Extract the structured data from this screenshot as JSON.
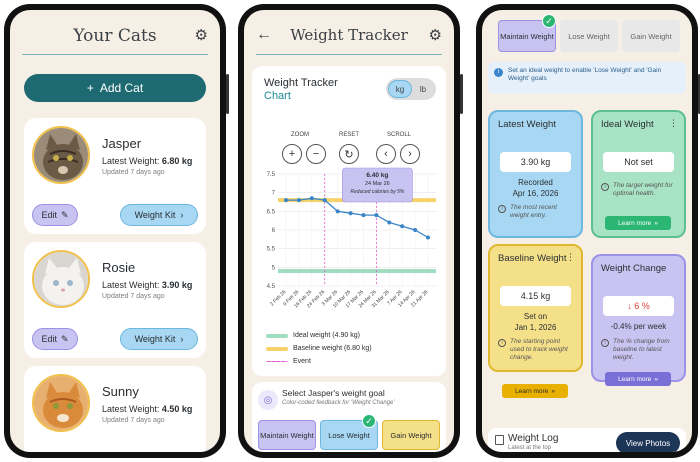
{
  "screen1": {
    "title": "Your Cats",
    "add_cat_label": "Add Cat",
    "cats": [
      {
        "name": "Jasper",
        "weight_prefix": "Latest Weight: ",
        "weight": "6.80 kg",
        "updated": "Updated 7 days ago",
        "edit_label": "Edit",
        "kit_label": "Weight Kit"
      },
      {
        "name": "Rosie",
        "weight_prefix": "Latest Weight: ",
        "weight": "3.90 kg",
        "updated": "Updated 7 days ago",
        "edit_label": "Edit",
        "kit_label": "Weight Kit"
      },
      {
        "name": "Sunny",
        "weight_prefix": "Latest Weight: ",
        "weight": "4.50 kg",
        "updated": "Updated 7 days ago"
      }
    ]
  },
  "screen2": {
    "title": "Weight Tracker",
    "card_title": "Weight Tracker",
    "card_subtitle": "Chart",
    "unit_kg": "kg",
    "unit_lb": "lb",
    "controls": {
      "zoom": "ZOOM",
      "reset": "RESET",
      "scroll": "SCROLL"
    },
    "tooltip": {
      "value": "6.40 kg",
      "date": "24 Mar 26",
      "note": "Reduced calories by 5%"
    },
    "legend": [
      {
        "label": "Ideal weight (4.90 kg)",
        "color": "#9fdcc0"
      },
      {
        "label": "Baseline weight (6.80 kg)",
        "color": "#f5d26a"
      },
      {
        "label": "Event",
        "color": "#e35bd0"
      }
    ],
    "goal_title": "Select Jasper's weight goal",
    "goal_subtitle": "Color-coded feedback for 'Weight Change'",
    "goal_options": [
      "Maintain Weight",
      "Lose Weight",
      "Gain Weight"
    ],
    "goal_selected": "Lose Weight"
  },
  "chart_data": {
    "type": "line",
    "x": [
      "2 Feb 26",
      "9 Feb 26",
      "16 Feb 26",
      "24 Feb 26",
      "3 Mar 26",
      "10 Mar 26",
      "17 Mar 26",
      "24 Mar 26",
      "31 Mar 26",
      "7 Apr 26",
      "14 Apr 26",
      "21 Apr 26"
    ],
    "series": [
      {
        "values": [
          6.8,
          6.8,
          6.85,
          6.8,
          6.5,
          6.45,
          6.4,
          6.4,
          6.2,
          6.1,
          6.0,
          5.8
        ]
      }
    ],
    "ideal_weight": 4.9,
    "baseline_weight": 6.8,
    "events": [
      "24 Feb 26",
      "24 Mar 26"
    ],
    "yticks": [
      "7.5",
      "7",
      "6.5",
      "6",
      "5.5",
      "5",
      "4.5"
    ],
    "ylim": [
      4.5,
      7.5
    ],
    "grid": true
  },
  "screen3": {
    "goal_tabs": [
      "Maintain Weight",
      "Lose Weight",
      "Gain Weight"
    ],
    "goal_active": "Maintain Weight",
    "info_text": "Set an ideal weight to enable 'Lose Weight' and 'Gain Weight' goals",
    "latest": {
      "title": "Latest Weight",
      "value": "3.90 kg",
      "recorded_label": "Recorded",
      "recorded_date": "Apr 16, 2026",
      "note": "The most recent weight entry."
    },
    "ideal": {
      "title": "Ideal Weight",
      "value": "Not set",
      "note": "The target weight for optimal health.",
      "learn": "Learn more"
    },
    "baseline": {
      "title": "Baseline Weight",
      "value": "4.15 kg",
      "set_label": "Set on",
      "set_date": "Jan 1, 2026",
      "note": "The starting point used to track weight change.",
      "learn": "Learn more"
    },
    "change": {
      "title": "Weight Change",
      "value": "6 %",
      "per_week": "-0.4% per week",
      "note": "The % change from baseline to latest weight.",
      "learn": "Learn more"
    },
    "log_title": "Weight Log",
    "log_sub": "Latest at the top",
    "photos_label": "View Photos"
  },
  "colors": {
    "teal": "#1e6a73",
    "lavender": "#c9c3f2",
    "sky": "#a7d7f2",
    "mint": "#9fdcc0",
    "gold": "#f5d26a",
    "event": "#e35bd0",
    "line": "#3a85c9",
    "down_red": "#e0413a"
  }
}
